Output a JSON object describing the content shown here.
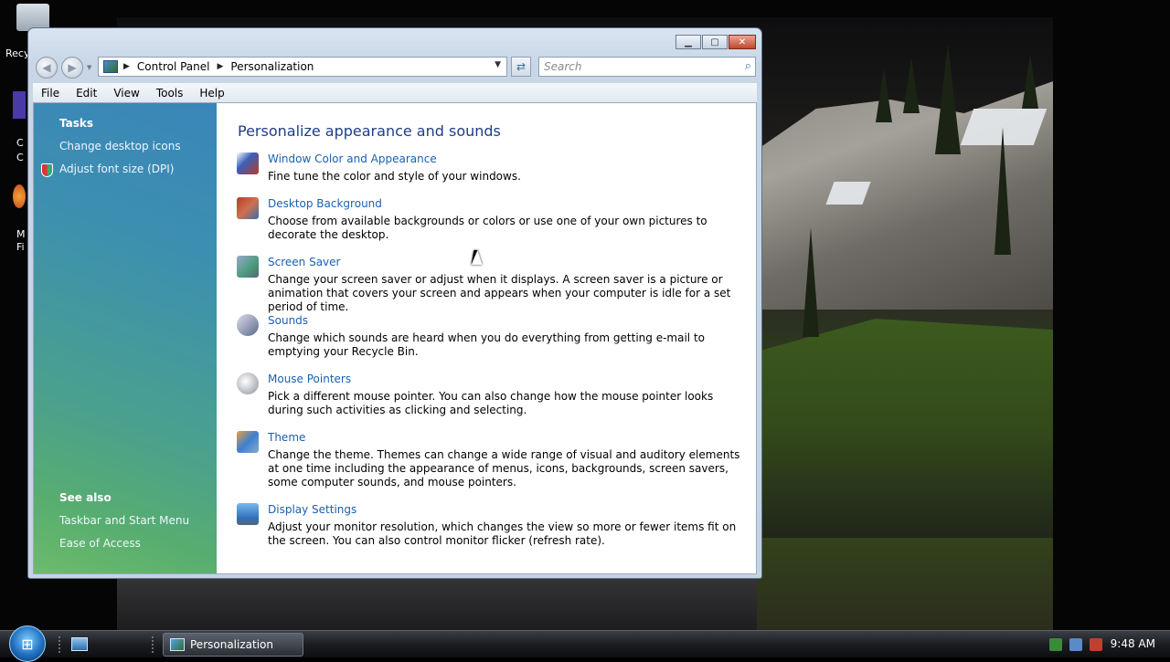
{
  "window": {
    "breadcrumbs": [
      "Control Panel",
      "Personalization"
    ],
    "search_placeholder": "Search"
  },
  "menu": [
    "File",
    "Edit",
    "View",
    "Tools",
    "Help"
  ],
  "tasks": {
    "heading": "Tasks",
    "links": [
      "Change desktop icons",
      "Adjust font size (DPI)"
    ]
  },
  "see_also": {
    "heading": "See also",
    "links": [
      "Taskbar and Start Menu",
      "Ease of Access"
    ]
  },
  "main": {
    "title": "Personalize appearance and sounds",
    "items": [
      {
        "title": "Window Color and Appearance",
        "desc": "Fine tune the color and style of your windows.",
        "icon": "window-color-icon",
        "color": "#3a5fb8"
      },
      {
        "title": "Desktop Background",
        "desc": "Choose from available backgrounds or colors or use one of your own pictures to decorate the desktop.",
        "icon": "desktop-background-icon",
        "color": "#b83a2a"
      },
      {
        "title": "Screen Saver",
        "desc": "Change your screen saver or adjust when it displays. A screen saver is a picture or animation that covers your screen and appears when your computer is idle for a set period of time.",
        "icon": "screen-saver-icon",
        "color": "#4a9a7a"
      },
      {
        "title": "Sounds",
        "desc": "Change which sounds are heard when you do everything from getting e-mail to emptying your Recycle Bin.",
        "icon": "sounds-icon",
        "color": "#5a6a88"
      },
      {
        "title": "Mouse Pointers",
        "desc": "Pick a different mouse pointer. You can also change how the mouse pointer looks during such activities as clicking and selecting.",
        "icon": "mouse-pointers-icon",
        "color": "#8a8f96"
      },
      {
        "title": "Theme",
        "desc": "Change the theme. Themes can change a wide range of visual and auditory elements at one time including the appearance of menus, icons, backgrounds, screen savers, some computer sounds, and mouse pointers.",
        "icon": "theme-icon",
        "color": "#3f7fd0"
      },
      {
        "title": "Display Settings",
        "desc": "Adjust your monitor resolution, which changes the view so more or fewer items fit on the screen. You can also control monitor flicker (refresh rate).",
        "icon": "display-settings-icon",
        "color": "#2f6fb8"
      }
    ]
  },
  "desktop_icons": [
    "Recy",
    "C",
    "C",
    "M",
    "Fi"
  ],
  "taskbar": {
    "active_window": "Personalization",
    "clock": "9:48 AM"
  }
}
